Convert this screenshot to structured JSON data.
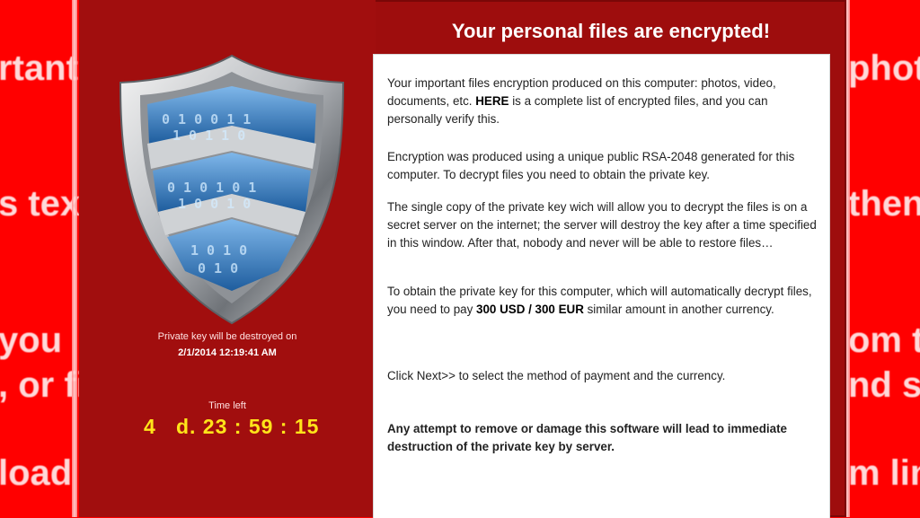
{
  "background": {
    "left_fragments": [
      "rtant",
      "s text",
      "you",
      ", or fi",
      "load"
    ],
    "right_fragments": [
      "phot",
      "then",
      "om th",
      "nd st",
      "m lin"
    ]
  },
  "window": {
    "title": "Your personal files are encrypted!",
    "left": {
      "shield_icon": "binary-shield-icon",
      "key_destroyed_label": "Private key will be destroyed on",
      "key_destroyed_date": "2/1/2014 12:19:41 AM",
      "time_left_label": "Time left",
      "countdown": "4   d. 23 : 59 : 15"
    },
    "message": {
      "p1_a": "Your important files encryption produced on this computer: photos, video, documents, etc. ",
      "p1_here": "HERE",
      "p1_b": " is a complete list of encrypted files, and you can personally verify this.",
      "p2": "Encryption was produced using a unique public RSA-2048 generated for this computer. To decrypt files you need to obtain the private key.",
      "p3": "The single copy of the private key wich will allow you to decrypt the files is on a secret server on the internet; the server will destroy the key after a time specified in this window. After that, nobody and never will be able to restore files…",
      "p4_a": "To obtain the private key for this computer, which will automatically decrypt files, you need to pay ",
      "p4_amount": "300 USD / 300 EUR",
      "p4_b": " similar amount in another currency.",
      "p5": "Click Next>>  to select the method of payment and the currency.",
      "warning": "Any attempt to remove or damage this software will lead to immediate destruction of the private key by server."
    }
  },
  "colors": {
    "backdrop": "#ff0000",
    "window": "#9e0d0d",
    "countdown": "#ffe41a",
    "warning": "#8c1111"
  }
}
